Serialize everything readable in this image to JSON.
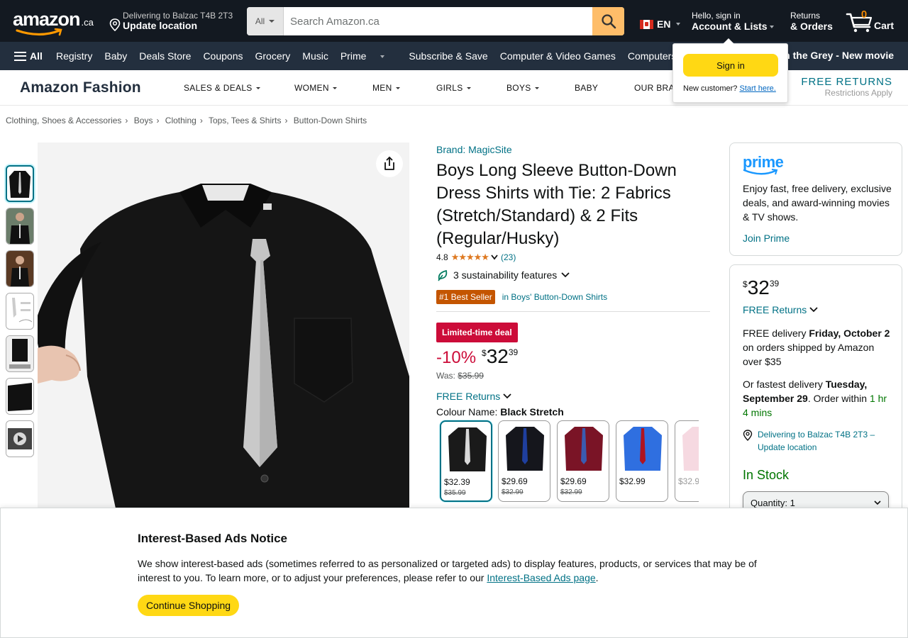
{
  "header": {
    "logo": {
      "text": "amazon",
      "suffix": ".ca"
    },
    "deliver": {
      "line1": "Delivering to Balzac T4B 2T3",
      "line2": "Update location"
    },
    "search": {
      "dept": "All",
      "placeholder": "Search Amazon.ca"
    },
    "lang": "EN",
    "account": {
      "line1": "Hello, sign in",
      "line2": "Account & Lists"
    },
    "orders": {
      "line1": "Returns",
      "line2": "& Orders"
    },
    "cart": {
      "count": "0",
      "label": "Cart"
    }
  },
  "nav": {
    "all": "All",
    "items": [
      "Registry",
      "Baby",
      "Deals Store",
      "Coupons",
      "Grocery",
      "Music",
      "Prime",
      "Subscribe & Save",
      "Computer & Video Games",
      "Computers"
    ],
    "promo": "n the Grey - New movie"
  },
  "fashion": {
    "brand": "Amazon Fashion",
    "categories": [
      "SALES & DEALS",
      "WOMEN",
      "MEN",
      "GIRLS",
      "BOYS",
      "BABY",
      "OUR BRA"
    ],
    "free_returns": "FREE RETURNS",
    "restrictions": "Restrictions Apply"
  },
  "flyout": {
    "button": "Sign in",
    "new_customer": "New customer?",
    "start_here": "Start here."
  },
  "breadcrumb": [
    "Clothing, Shoes & Accessories",
    "Boys",
    "Clothing",
    "Tops, Tees & Shirts",
    "Button-Down Shirts"
  ],
  "product": {
    "brand": "Brand: MagicSite",
    "title": "Boys Long Sleeve Button-Down Dress Shirts with Tie: 2 Fabrics (Stretch/Standard) & 2 Fits (Regular/Husky)",
    "rating": "4.8",
    "stars": "★★★★★",
    "rating_count": "(23)",
    "sustainability": "3 sustainability features",
    "best_seller": "#1 Best Seller",
    "best_seller_cat": "in Boys' Button-Down Shirts",
    "deal_badge": "Limited-time deal",
    "discount": "-10%",
    "currency": "$",
    "price_whole": "32",
    "price_frac": "39",
    "was_label": "Was:",
    "was_price": "$35.99",
    "free_returns": "FREE Returns",
    "colour_label": "Colour Name:",
    "colour_value": "Black Stretch",
    "swatches": [
      {
        "price": "$32.39",
        "was": "$35.99",
        "shirt": "#1a1a1a",
        "tie": "#d9d9d9"
      },
      {
        "price": "$29.69",
        "was": "$32.99",
        "shirt": "#15161c",
        "tie": "#1f3f9e"
      },
      {
        "price": "$29.69",
        "was": "$32.99",
        "shirt": "#7a1426",
        "tie": "#3b5bb0"
      },
      {
        "price": "$32.99",
        "was": "",
        "shirt": "#2f6fe0",
        "tie": "#b01420"
      },
      {
        "price": "$32.9",
        "was": "",
        "shirt": "#f6d9e1",
        "tie": "#f0a9bd"
      }
    ]
  },
  "prime": {
    "logo": "prime",
    "text": "Enjoy fast, free delivery, exclusive deals, and award-winning movies & TV shows.",
    "join": "Join Prime"
  },
  "buybox": {
    "currency": "$",
    "whole": "32",
    "frac": "39",
    "free_returns": "FREE Returns",
    "delivery_pre": "FREE delivery ",
    "delivery_date": "Friday, October 2",
    "delivery_post": " on orders shipped by Amazon over $35",
    "fast_pre": "Or fastest delivery ",
    "fast_date": "Tuesday, September 29",
    "fast_mid": ". Order within ",
    "fast_time": "1 hr 4 mins",
    "location": "Delivering to Balzac T4B 2T3 – Update location",
    "stock": "In Stock",
    "qty_label": "Quantity:",
    "qty_value": "1"
  },
  "ads_notice": {
    "title": "Interest-Based Ads Notice",
    "body": "We show interest-based ads (sometimes referred to as personalized or targeted ads) to display features, products, or services that may be of interest to you. To learn more, or to adjust your preferences, please refer to our ",
    "link": "Interest-Based Ads page",
    "end": ".",
    "button": "Continue Shopping"
  },
  "colors": {
    "nav": "#131921",
    "nav2": "#232f3e",
    "link": "#007185",
    "deal": "#cc0c39",
    "button": "#ffd814",
    "search_btn": "#febd69"
  }
}
